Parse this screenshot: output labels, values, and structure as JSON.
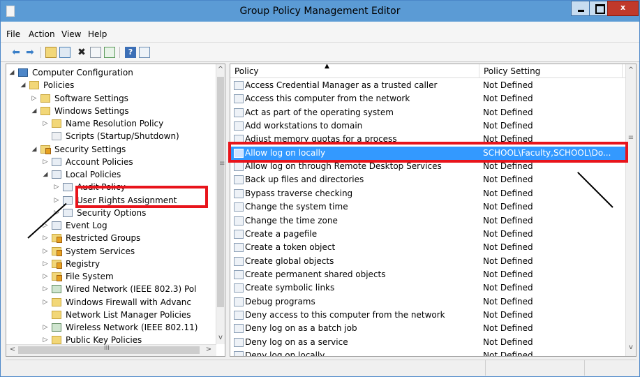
{
  "window": {
    "title": "Group Policy Management Editor",
    "close_label": "x"
  },
  "menu": {
    "items": [
      "File",
      "Action",
      "View",
      "Help"
    ]
  },
  "toolbar": {
    "icons": [
      "back-arrow-icon",
      "forward-arrow-icon",
      "up-folder-icon",
      "show-hide-tree-icon",
      "delete-icon",
      "properties-icon",
      "export-list-icon",
      "help-icon",
      "console-tree-icon"
    ]
  },
  "tree": {
    "items": [
      {
        "label": "Computer Configuration",
        "icon": "computer-icon",
        "arrow": "◢"
      },
      {
        "label": "Policies",
        "icon": "folder-icon",
        "arrow": "◢"
      },
      {
        "label": "Software Settings",
        "icon": "folder-icon",
        "arrow": "▷"
      },
      {
        "label": "Windows Settings",
        "icon": "folder-icon",
        "arrow": "◢"
      },
      {
        "label": "Name Resolution Policy",
        "icon": "folder-icon",
        "arrow": "▷"
      },
      {
        "label": "Scripts (Startup/Shutdown)",
        "icon": "script-icon",
        "arrow": ""
      },
      {
        "label": "Security Settings",
        "icon": "security-settings-icon",
        "arrow": "◢"
      },
      {
        "label": "Account Policies",
        "icon": "policy-icon",
        "arrow": "▷"
      },
      {
        "label": "Local Policies",
        "icon": "policy-icon",
        "arrow": "◢"
      },
      {
        "label": "Audit Policy",
        "icon": "policy-icon",
        "arrow": "▷"
      },
      {
        "label": "User Rights Assignment",
        "icon": "policy-icon",
        "arrow": "▷"
      },
      {
        "label": "Security Options",
        "icon": "policy-icon",
        "arrow": "▷"
      },
      {
        "label": "Event Log",
        "icon": "policy-icon",
        "arrow": "▷"
      },
      {
        "label": "Restricted Groups",
        "icon": "secure-folder-icon",
        "arrow": "▷"
      },
      {
        "label": "System Services",
        "icon": "secure-folder-icon",
        "arrow": "▷"
      },
      {
        "label": "Registry",
        "icon": "secure-folder-icon",
        "arrow": "▷"
      },
      {
        "label": "File System",
        "icon": "secure-folder-icon",
        "arrow": "▷"
      },
      {
        "label": "Wired Network (IEEE 802.3) Pol",
        "icon": "network-policy-icon",
        "arrow": "▷"
      },
      {
        "label": "Windows Firewall with Advanc",
        "icon": "folder-icon",
        "arrow": "▷"
      },
      {
        "label": "Network List Manager Policies",
        "icon": "folder-icon",
        "arrow": ""
      },
      {
        "label": "Wireless Network (IEEE 802.11)",
        "icon": "network-policy-icon",
        "arrow": "▷"
      },
      {
        "label": "Public Key Policies",
        "icon": "folder-icon",
        "arrow": "▷"
      }
    ],
    "scroll_thumb": "III"
  },
  "list": {
    "columns": [
      "Policy",
      "Policy Setting"
    ],
    "rows": [
      {
        "policy": "Access Credential Manager as a trusted caller",
        "setting": "Not Defined"
      },
      {
        "policy": "Access this computer from the network",
        "setting": "Not Defined"
      },
      {
        "policy": "Act as part of the operating system",
        "setting": "Not Defined"
      },
      {
        "policy": "Add workstations to domain",
        "setting": "Not Defined"
      },
      {
        "policy": "Adjust memory quotas for a process",
        "setting": "Not Defined"
      },
      {
        "policy": "Allow log on locally",
        "setting": "SCHOOL\\Faculty,SCHOOL\\Do..."
      },
      {
        "policy": "Allow log on through Remote Desktop Services",
        "setting": "Not Defined"
      },
      {
        "policy": "Back up files and directories",
        "setting": "Not Defined"
      },
      {
        "policy": "Bypass traverse checking",
        "setting": "Not Defined"
      },
      {
        "policy": "Change the system time",
        "setting": "Not Defined"
      },
      {
        "policy": "Change the time zone",
        "setting": "Not Defined"
      },
      {
        "policy": "Create a pagefile",
        "setting": "Not Defined"
      },
      {
        "policy": "Create a token object",
        "setting": "Not Defined"
      },
      {
        "policy": "Create global objects",
        "setting": "Not Defined"
      },
      {
        "policy": "Create permanent shared objects",
        "setting": "Not Defined"
      },
      {
        "policy": "Create symbolic links",
        "setting": "Not Defined"
      },
      {
        "policy": "Debug programs",
        "setting": "Not Defined"
      },
      {
        "policy": "Deny access to this computer from the network",
        "setting": "Not Defined"
      },
      {
        "policy": "Deny log on as a batch job",
        "setting": "Not Defined"
      },
      {
        "policy": "Deny log on as a service",
        "setting": "Not Defined"
      },
      {
        "policy": "Deny log on locally",
        "setting": "Not Defined"
      }
    ],
    "selected_index": 5
  },
  "colors": {
    "titlebar": "#5b9bd5",
    "selection": "#3399ff",
    "highlight_box": "#e8141b"
  }
}
